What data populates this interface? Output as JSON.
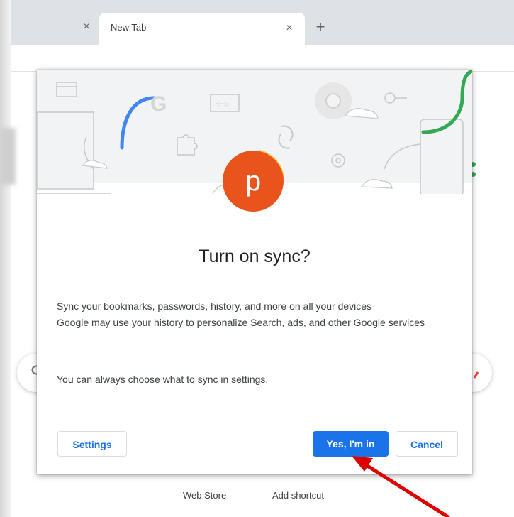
{
  "browser": {
    "tabs": [
      {
        "title": "New Tab",
        "active": true
      }
    ],
    "new_tab_symbol": "+",
    "close_symbol": "×"
  },
  "dialog": {
    "avatar_letter": "p",
    "avatar_color": "#e8541c",
    "title": "Turn on sync?",
    "body_lines": [
      "Sync your bookmarks, passwords, history, and more on all your devices",
      "Google may use your history to personalize Search, ads, and other Google services"
    ],
    "settings_note": "You can always choose what to sync in settings.",
    "buttons": {
      "settings": "Settings",
      "confirm": "Yes, I'm in",
      "cancel": "Cancel"
    },
    "accent": "#1a73e8"
  },
  "background_page": {
    "shortcuts": [
      "Web Store",
      "Add shortcut"
    ]
  },
  "annotation": {
    "arrow_color": "#e00000",
    "points_to": "confirm-button"
  }
}
